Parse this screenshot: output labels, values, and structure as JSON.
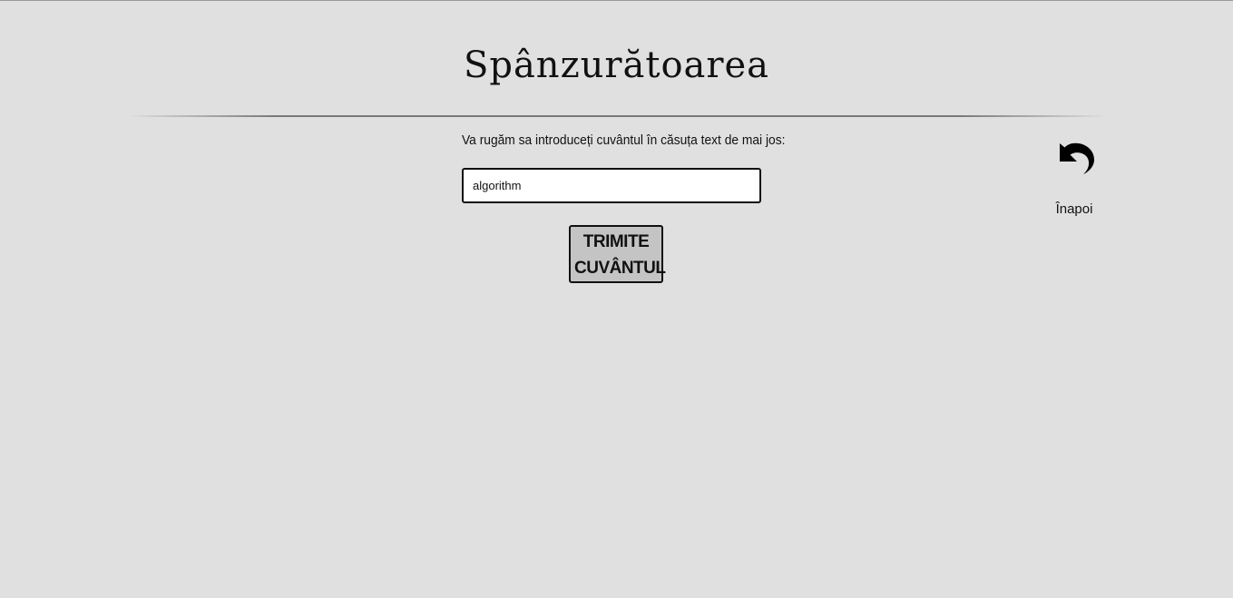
{
  "header": {
    "title": "Spânzurătoarea"
  },
  "form": {
    "prompt": "Va rugăm sa introduceți cuvântul în căsuța text de mai jos:",
    "input_value": "algorithm",
    "submit_label_line1": "TRIMITE",
    "submit_label_line2": "CUVÂNTUL"
  },
  "nav": {
    "back_label": "Înapoi",
    "back_icon": "undo-arrow-icon"
  }
}
